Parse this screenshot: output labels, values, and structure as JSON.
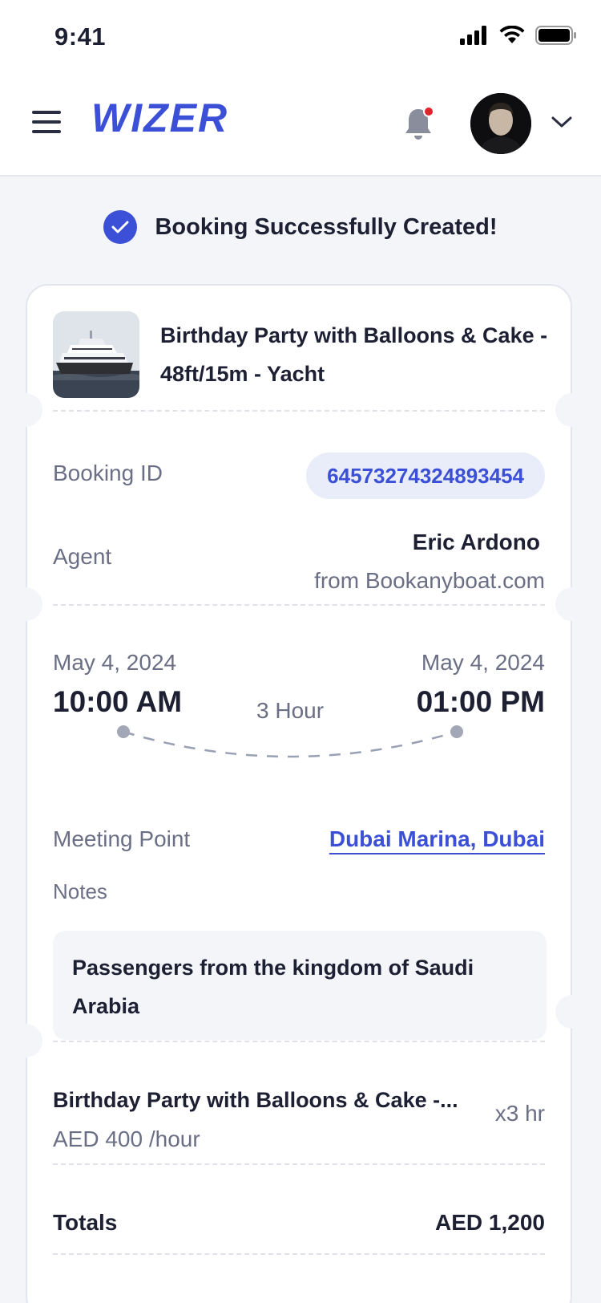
{
  "status_bar": {
    "time": "9:41"
  },
  "header": {
    "logo": "WIZER"
  },
  "banner": {
    "message": "Booking Successfully Created!"
  },
  "booking": {
    "title": "Birthday Party with Balloons & Cake - 48ft/15m - Yacht",
    "booking_id_label": "Booking ID",
    "booking_id": "64573274324893454",
    "agent_label": "Agent",
    "agent_name": "Eric Ardono",
    "agent_from": "from Bookanyboat.com",
    "start_date": "May 4, 2024",
    "start_time": "10:00 AM",
    "duration": "3 Hour",
    "end_date": "May 4, 2024",
    "end_time": "01:00 PM",
    "meeting_point_label": "Meeting Point",
    "meeting_point": "Dubai Marina, Dubai",
    "notes_label": "Notes",
    "notes": "Passengers from the kingdom of Saudi Arabia",
    "line_item_name": "Birthday Party with Balloons & Cake -...",
    "line_item_rate": "AED 400 /hour",
    "line_item_qty": "x3 hr",
    "totals_label": "Totals",
    "totals_value": "AED 1,200"
  },
  "colors": {
    "accent": "#3b50d6",
    "background": "#f3f5f9",
    "notification_dot": "#e0242b"
  },
  "icons": [
    "signal-icon",
    "wifi-icon",
    "battery-icon",
    "menu-icon",
    "bell-icon",
    "chevron-down-icon",
    "check-icon"
  ]
}
